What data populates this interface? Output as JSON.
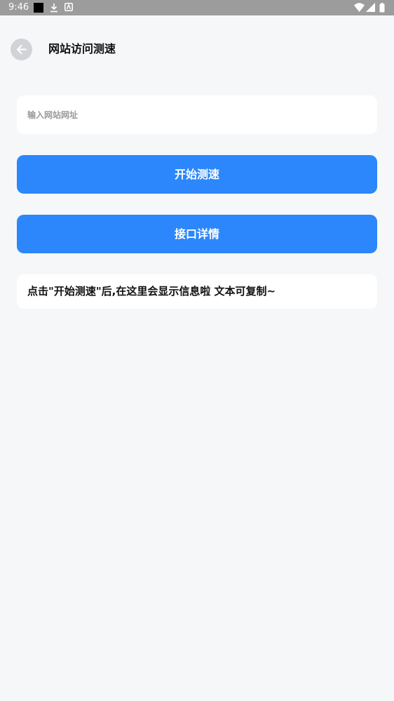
{
  "status_bar": {
    "time": "9:46",
    "left_icons": [
      "notification-square-icon",
      "download-icon",
      "app-a-icon"
    ],
    "right_icons": [
      "wifi-icon",
      "cell-signal-icon",
      "battery-icon"
    ]
  },
  "header": {
    "title": "网站访问测速",
    "back_icon": "arrow-left-icon"
  },
  "url_input": {
    "value": "",
    "placeholder": "输入网站网址"
  },
  "buttons": {
    "start_label": "开始测速",
    "api_label": "接口详情"
  },
  "result": {
    "text": "点击\"开始测速\"后,在这里会显示信息啦 文本可复制~"
  },
  "colors": {
    "accent": "#2b87fb",
    "background": "#f6f7f9",
    "card": "#ffffff",
    "status_bar": "#9c9c9c"
  }
}
